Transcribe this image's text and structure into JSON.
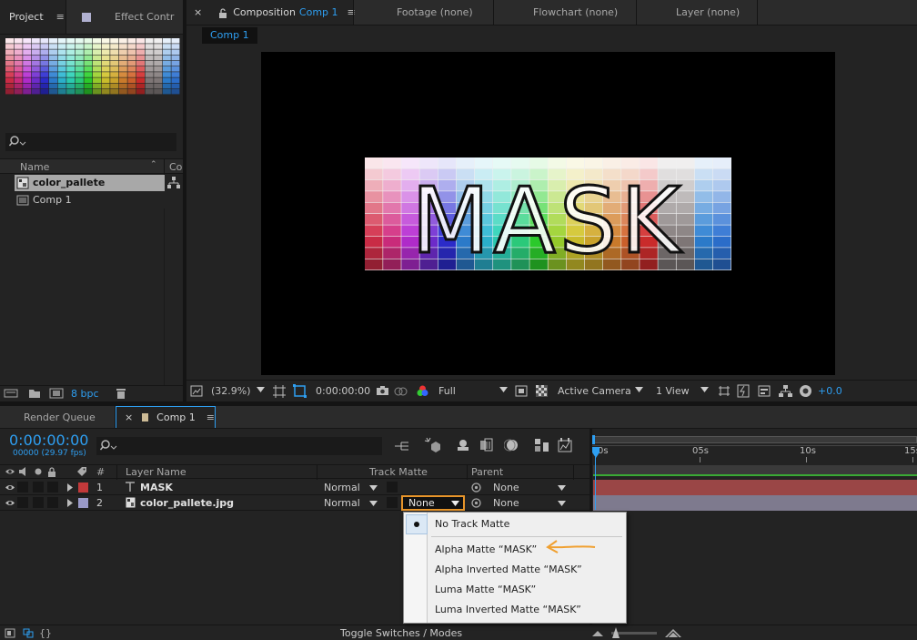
{
  "project_panel": {
    "tab_project": "Project",
    "tab_effect": "Effect Contr",
    "search_placeholder": "",
    "columns": {
      "name": "Name",
      "comment": "Co"
    },
    "items": [
      {
        "name": "color_pallete",
        "selected": true
      },
      {
        "name": "Comp 1",
        "selected": false
      }
    ],
    "bpc": "8 bpc"
  },
  "viewer": {
    "tab_composition": "Composition",
    "tab_composition_name": "Comp 1",
    "tab_footage": "Footage (none)",
    "tab_flowchart": "Flowchart (none)",
    "tab_layer": "Layer (none)",
    "comp_button": "Comp 1",
    "mask_text": "MASK",
    "toolbar": {
      "zoom": "(32.9%)",
      "timecode": "0:00:00:00",
      "resolution": "Full",
      "camera": "Active Camera",
      "views": "1 View",
      "exposure": "+0.0"
    }
  },
  "timeline": {
    "tab_render_queue": "Render Queue",
    "tab_comp": "Comp 1",
    "timecode": "0:00:00:00",
    "fps": "00000 (29.97 fps)",
    "columns": {
      "num": "#",
      "layer_name": "Layer Name",
      "track_matte": "Track Matte",
      "parent": "Parent"
    },
    "layers": [
      {
        "num": "1",
        "name": "MASK",
        "color": "#c2393a",
        "mode": "Normal",
        "matte": "",
        "parent": "None"
      },
      {
        "num": "2",
        "name": "color_pallete.jpg",
        "color": "#9a9ac8",
        "mode": "Normal",
        "matte": "None",
        "parent": "None"
      }
    ],
    "ruler": [
      "0s",
      "05s",
      "10s",
      "15s"
    ],
    "toggle_label": "Toggle Switches / Modes"
  },
  "matte_menu": {
    "items": [
      {
        "label": "No Track Matte",
        "checked": true
      },
      {
        "label": "Alpha Matte “MASK”",
        "checked": false
      },
      {
        "label": "Alpha Inverted Matte “MASK”",
        "checked": false
      },
      {
        "label": "Luma Matte “MASK”",
        "checked": false
      },
      {
        "label": "Luma Inverted Matte “MASK”",
        "checked": false
      }
    ]
  },
  "colors": {
    "accent_blue": "#2e9ff2",
    "annotation_orange": "#f0a030",
    "layer1_bar": "#a64040",
    "layer2_bar": "#7a7890",
    "work_area": "#3aaa35"
  }
}
